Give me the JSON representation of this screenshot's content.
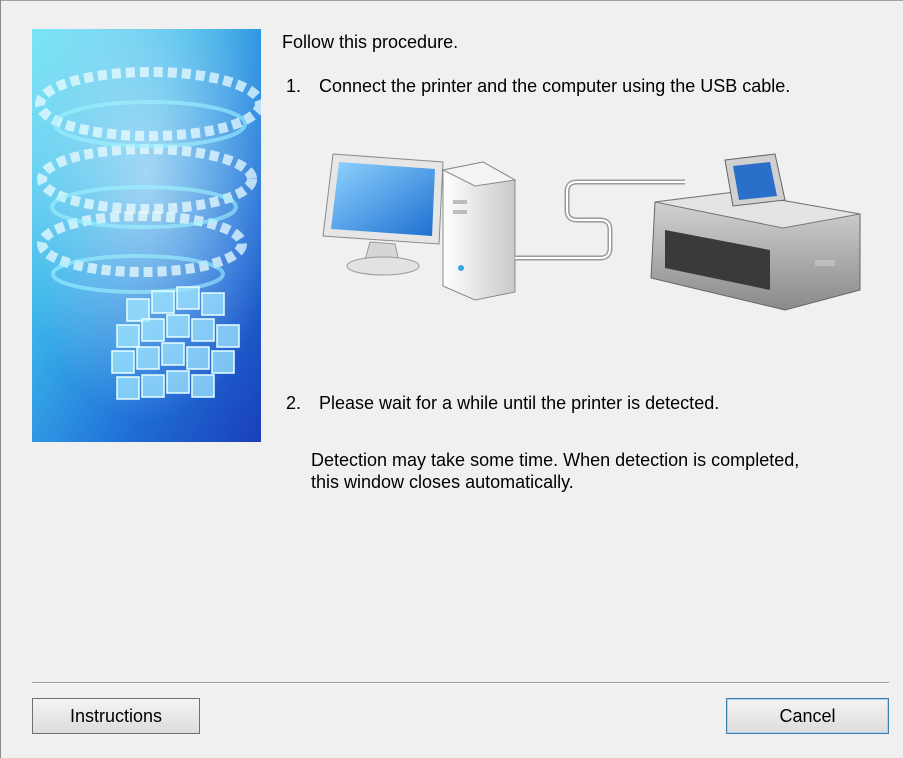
{
  "content": {
    "intro": "Follow this procedure.",
    "step1_number": "1.",
    "step1_text": "Connect the printer and the computer using the USB cable.",
    "step2_number": "2.",
    "step2_text": "Please wait for a while until the printer is detected.",
    "note_line1": "Detection may take some time. When detection is completed,",
    "note_line2": "this window closes automatically."
  },
  "buttons": {
    "instructions_label": "Instructions",
    "cancel_label": "Cancel"
  },
  "icons": {
    "banner": "canon-swirl-banner-image",
    "computer": "desktop-computer-icon",
    "printer": "printer-icon",
    "cable": "usb-cable-icon"
  },
  "colors": {
    "background": "#f0f0f0",
    "banner_blue": "#1a5fd0",
    "cancel_border": "#3c7fb1"
  }
}
